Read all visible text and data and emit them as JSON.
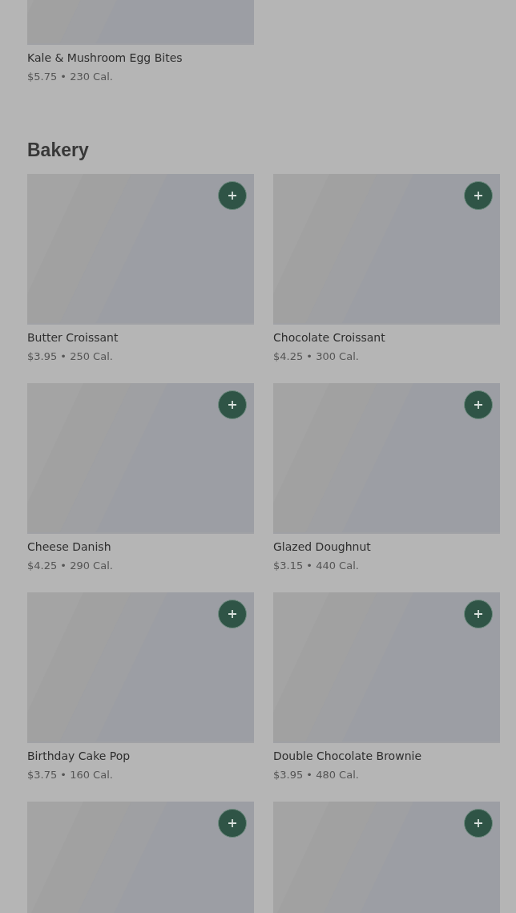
{
  "sections": [
    {
      "items": [
        {
          "name": "Kale & Mushroom Egg Bites",
          "meta": "$5.75 • 230 Cal."
        }
      ]
    },
    {
      "title": "Bakery",
      "items": [
        {
          "name": "Butter Croissant",
          "meta": "$3.95 • 250 Cal."
        },
        {
          "name": "Chocolate Croissant",
          "meta": "$4.25 • 300 Cal."
        },
        {
          "name": "Cheese Danish",
          "meta": "$4.25 • 290 Cal."
        },
        {
          "name": "Glazed Doughnut",
          "meta": "$3.15 • 440 Cal."
        },
        {
          "name": "Birthday Cake Pop",
          "meta": "$3.75 • 160 Cal."
        },
        {
          "name": "Double Chocolate Brownie",
          "meta": "$3.95 • 480 Cal."
        },
        {
          "kind": "picture"
        },
        {
          "kind": "picture"
        }
      ]
    }
  ]
}
